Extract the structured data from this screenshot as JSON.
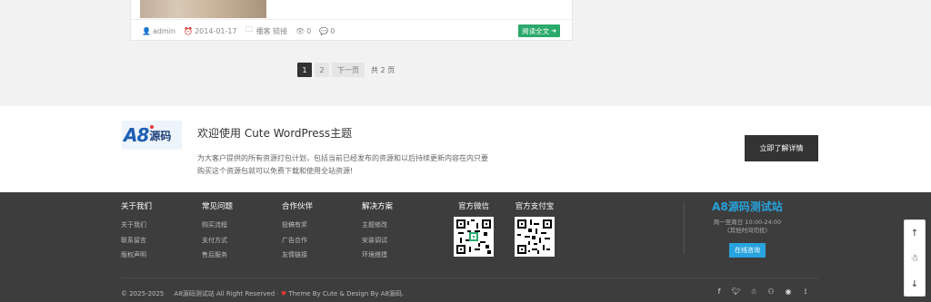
{
  "post": {
    "author": "admin",
    "date": "2014-01-17",
    "tags": "播客 链接",
    "views": "0",
    "comments": "0",
    "read_more": "阅读全文"
  },
  "pagination": {
    "pages": [
      "1",
      "2"
    ],
    "current": "1",
    "next": "下一页",
    "total": "共 2 页"
  },
  "cta": {
    "logo_a8": "A8",
    "logo_text": "源码",
    "title": "欢迎使用 Cute WordPress主题",
    "description": "为大客户提供的所有资源打包计划，包括当前已经发布的资源和以后持续更新内容在内只要购买这个资源包就可以免费下载和使用全站资源!",
    "button": "立即了解详情"
  },
  "footer": {
    "columns": [
      {
        "title": "关于我们",
        "links": [
          "关于我们",
          "联系留言",
          "版权声明"
        ]
      },
      {
        "title": "常见问题",
        "links": [
          "购买流程",
          "支付方式",
          "售后服务"
        ]
      },
      {
        "title": "合作伙伴",
        "links": [
          "投稿有奖",
          "广告合作",
          "友情链接"
        ]
      },
      {
        "title": "解决方案",
        "links": [
          "主题修改",
          "安装调试",
          "环境搭建"
        ]
      }
    ],
    "qr_wechat_title": "官方微信",
    "qr_alipay_title": "官方支付宝",
    "site_name": "A8源码测试站",
    "hours_line1": "周一至周日 10:00-24:00",
    "hours_line2": "(其他时间勿扰)",
    "consult_button": "在线咨询",
    "copyright": "© 2025-2025",
    "copyright_site": "A8源码测试站 All Right Reserved",
    "theme_credit": "Theme By Cute & Design By A8源码.",
    "social_icons": [
      "facebook-icon",
      "twitter-icon",
      "qq-icon",
      "qq-group-icon",
      "weibo-icon",
      "rss-icon"
    ]
  },
  "side": {
    "icons": [
      "arrow-up-icon",
      "qq-icon",
      "arrow-down-icon"
    ]
  },
  "colors": {
    "accent_green": "#2aa96b",
    "accent_blue": "#27a3dd",
    "footer_bg": "#3d3d3d"
  }
}
